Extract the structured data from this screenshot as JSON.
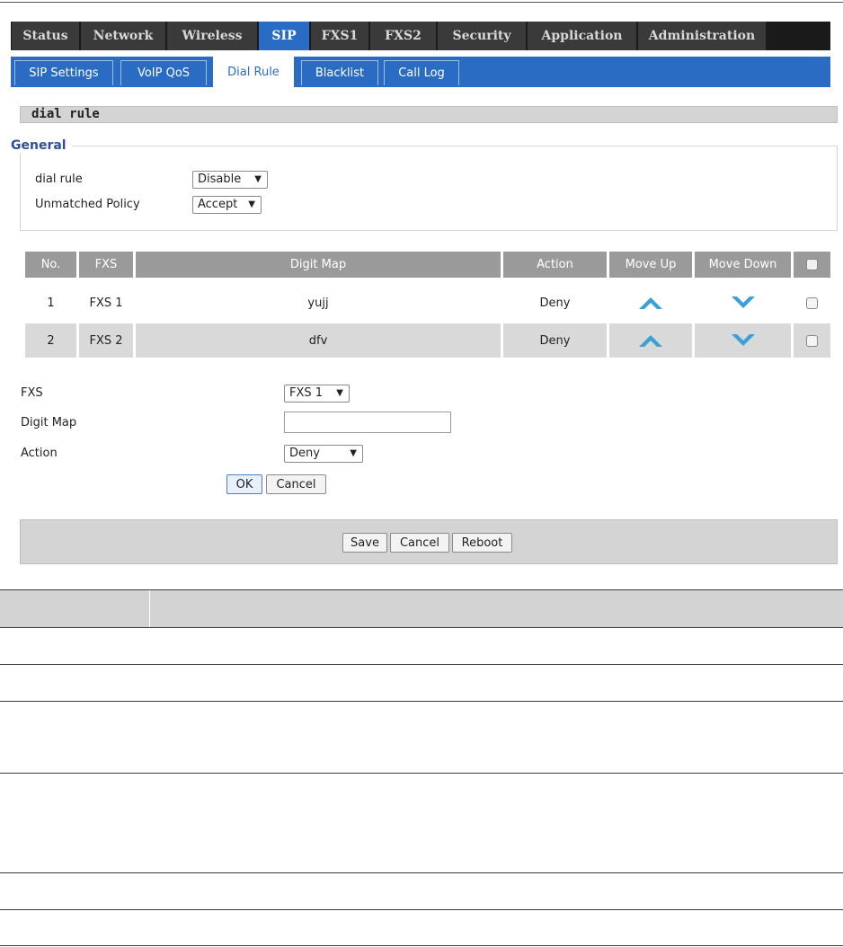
{
  "top_nav": {
    "tabs": [
      "Status",
      "Network",
      "Wireless",
      "SIP",
      "FXS1",
      "FXS2",
      "Security",
      "Application",
      "Administration"
    ],
    "active": "SIP"
  },
  "sub_nav": {
    "tabs": [
      "SIP Settings",
      "VoIP QoS",
      "Dial Rule",
      "Blacklist",
      "Call Log"
    ],
    "active": "Dial Rule"
  },
  "section_title": "dial rule",
  "general": {
    "legend": "General",
    "dial_rule_label": "dial rule",
    "dial_rule_value": "Disable",
    "unmatched_policy_label": "Unmatched Policy",
    "unmatched_policy_value": "Accept"
  },
  "table": {
    "headers": [
      "No.",
      "FXS",
      "Digit Map",
      "Action",
      "Move Up",
      "Move Down"
    ],
    "rows": [
      {
        "no": "1",
        "fxs": "FXS 1",
        "digit_map": "yujj",
        "action": "Deny"
      },
      {
        "no": "2",
        "fxs": "FXS 2",
        "digit_map": "dfv",
        "action": "Deny"
      }
    ]
  },
  "form": {
    "fxs_label": "FXS",
    "fxs_value": "FXS 1",
    "digit_map_label": "Digit Map",
    "digit_map_value": "",
    "action_label": "Action",
    "action_value": "Deny",
    "ok_label": "OK",
    "cancel_label": "Cancel"
  },
  "footer": {
    "save_label": "Save",
    "cancel_label": "Cancel",
    "reboot_label": "Reboot"
  },
  "colors": {
    "nav_active": "#2a6cc4",
    "nav_bg": "#1a1a1a",
    "arrow": "#3aa0d6",
    "legend": "#2e4e9a"
  },
  "arrow_glyph": "▼"
}
